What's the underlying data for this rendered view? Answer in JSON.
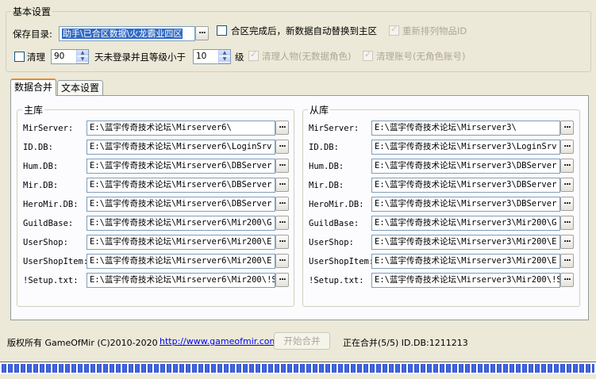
{
  "basic": {
    "legend": "基本设置",
    "save_dir_label": "保存目录:",
    "save_dir_value": "助手\\已合区数据\\火龙霸业四区",
    "auto_replace_label": "合区完成后，新数据自动替换到主区",
    "auto_replace_checked": false,
    "reorder_label": "重新排列物品ID",
    "reorder_checked": true,
    "clean_label": "清理",
    "clean_checked": false,
    "days_value": "90",
    "days_text": "天未登录并且等级小于",
    "level_value": "10",
    "level_unit": "级",
    "clean_chars_label": "清理人物(无数据角色)",
    "clean_chars_checked": true,
    "clean_accounts_label": "清理账号(无角色账号)",
    "clean_accounts_checked": true,
    "browse_glyph": "..."
  },
  "tabs": [
    {
      "label": "数据合并",
      "active": true
    },
    {
      "label": "文本设置",
      "active": false
    }
  ],
  "main_lib": {
    "legend": "主库",
    "rows": [
      {
        "label": "MirServer:",
        "value": "E:\\蓝宇传奇技术论坛\\Mirserver6\\"
      },
      {
        "label": "ID.DB:",
        "value": "E:\\蓝宇传奇技术论坛\\Mirserver6\\LoginSrv"
      },
      {
        "label": "Hum.DB:",
        "value": "E:\\蓝宇传奇技术论坛\\Mirserver6\\DBServer"
      },
      {
        "label": "Mir.DB:",
        "value": "E:\\蓝宇传奇技术论坛\\Mirserver6\\DBServer"
      },
      {
        "label": "HeroMir.DB:",
        "value": "E:\\蓝宇传奇技术论坛\\Mirserver6\\DBServer"
      },
      {
        "label": "GuildBase:",
        "value": "E:\\蓝宇传奇技术论坛\\Mirserver6\\Mir200\\G"
      },
      {
        "label": "UserShop:",
        "value": "E:\\蓝宇传奇技术论坛\\Mirserver6\\Mir200\\E"
      },
      {
        "label": "UserShopItem:",
        "value": "E:\\蓝宇传奇技术论坛\\Mirserver6\\Mir200\\E"
      },
      {
        "label": "!Setup.txt:",
        "value": "E:\\蓝宇传奇技术论坛\\Mirserver6\\Mir200\\!S"
      }
    ]
  },
  "slave_lib": {
    "legend": "从库",
    "rows": [
      {
        "label": "MirServer:",
        "value": "E:\\蓝宇传奇技术论坛\\Mirserver3\\"
      },
      {
        "label": "ID.DB:",
        "value": "E:\\蓝宇传奇技术论坛\\Mirserver3\\LoginSrv"
      },
      {
        "label": "Hum.DB:",
        "value": "E:\\蓝宇传奇技术论坛\\Mirserver3\\DBServer"
      },
      {
        "label": "Mir.DB:",
        "value": "E:\\蓝宇传奇技术论坛\\Mirserver3\\DBServer"
      },
      {
        "label": "HeroMir.DB:",
        "value": "E:\\蓝宇传奇技术论坛\\Mirserver3\\DBServer"
      },
      {
        "label": "GuildBase:",
        "value": "E:\\蓝宇传奇技术论坛\\Mirserver3\\Mir200\\G"
      },
      {
        "label": "UserShop:",
        "value": "E:\\蓝宇传奇技术论坛\\Mirserver3\\Mir200\\E"
      },
      {
        "label": "UserShopItem:",
        "value": "E:\\蓝宇传奇技术论坛\\Mirserver3\\Mir200\\E"
      },
      {
        "label": "!Setup.txt:",
        "value": "E:\\蓝宇传奇技术论坛\\Mirserver3\\Mir200\\!S"
      }
    ]
  },
  "footer": {
    "copyright": "版权所有 GameOfMir (C)2010-2020",
    "link": "http://www.gameofmir.com",
    "start_button": "开始合并",
    "status": "正在合并(5/5) ID.DB:1211213"
  },
  "progress_fraction": 1.0,
  "colors": {
    "window_bg": "#ece9d8",
    "selection": "#316ac5",
    "link": "#0000ff",
    "progress": "#2f50c8"
  }
}
